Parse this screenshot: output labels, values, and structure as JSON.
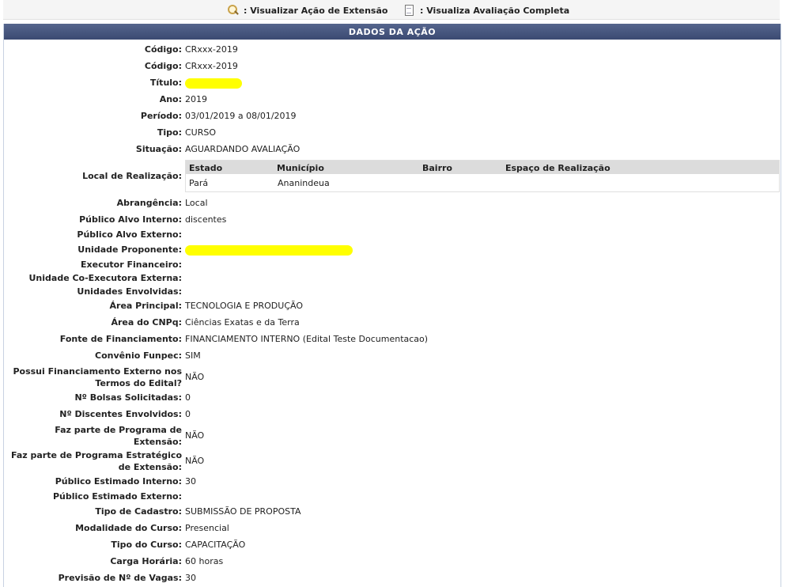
{
  "toolbar": {
    "view_action_label": ": Visualizar Ação de Extensão",
    "view_evaluation_label": ": Visualiza Avaliação Completa"
  },
  "panel": {
    "caption": "DADOS DA AÇÃO"
  },
  "fields": {
    "codigo1": {
      "label": "Código:",
      "value": "CRxxx-2019"
    },
    "codigo2": {
      "label": "Código:",
      "value": "CRxxx-2019"
    },
    "titulo": {
      "label": "Título:"
    },
    "ano": {
      "label": "Ano:",
      "value": "2019"
    },
    "periodo": {
      "label": "Período:",
      "value": "03/01/2019 a 08/01/2019"
    },
    "tipo": {
      "label": "Tipo:",
      "value": "CURSO"
    },
    "situacao": {
      "label": "Situação:",
      "value": "AGUARDANDO AVALIAÇÃO"
    },
    "local": {
      "label": "Local de Realização:"
    },
    "abrangencia": {
      "label": "Abrangência:",
      "value": "Local"
    },
    "publico_interno": {
      "label": "Público Alvo Interno:",
      "value": "discentes"
    },
    "publico_externo": {
      "label": "Público Alvo Externo:",
      "value": ""
    },
    "unidade_proponente": {
      "label": "Unidade Proponente:"
    },
    "executor": {
      "label": "Executor Financeiro:",
      "value": ""
    },
    "coexecutora": {
      "label": "Unidade Co-Executora Externa:",
      "value": ""
    },
    "envolvidas": {
      "label": "Unidades Envolvidas:",
      "value": ""
    },
    "area_principal": {
      "label": "Área Principal:",
      "value": "TECNOLOGIA E PRODUÇÃO"
    },
    "area_cnpq": {
      "label": "Área do CNPq:",
      "value": "Ciências Exatas e da Terra"
    },
    "fonte": {
      "label": "Fonte de Financiamento:",
      "value": "FINANCIAMENTO INTERNO (Edital Teste Documentacao)"
    },
    "convenio": {
      "label": "Convênio Funpec:",
      "value": "SIM"
    },
    "fin_externo": {
      "label_line1": "Possui Financiamento Externo nos",
      "label_line2": "Termos do Edital?",
      "value": "NÃO"
    },
    "bolsas": {
      "label": "Nº Bolsas Solicitadas:",
      "value": "0"
    },
    "discentes": {
      "label": "Nº Discentes Envolvidos:",
      "value": "0"
    },
    "programa": {
      "label_line1": "Faz parte de Programa de",
      "label_line2": "Extensão:",
      "value": "NÃO"
    },
    "estrategico": {
      "label_line1": "Faz parte de Programa Estratégico",
      "label_line2": "de Extensão:",
      "value": "NÃO"
    },
    "est_interno": {
      "label": "Público Estimado Interno:",
      "value": "30"
    },
    "est_externo": {
      "label": "Público Estimado Externo:",
      "value": ""
    },
    "cadastro": {
      "label": "Tipo de Cadastro:",
      "value": "SUBMISSÃO DE PROPOSTA"
    },
    "modalidade": {
      "label": "Modalidade do Curso:",
      "value": "Presencial"
    },
    "tipo_curso": {
      "label": "Tipo do Curso:",
      "value": "CAPACITAÇÃO"
    },
    "carga": {
      "label": "Carga Horária:",
      "value": "60 horas"
    },
    "vagas": {
      "label": "Previsão de Nº de Vagas:",
      "value": "30"
    }
  },
  "local_table": {
    "headers": [
      "Estado",
      "Município",
      "Bairro",
      "Espaço de Realização"
    ],
    "row": [
      "Pará",
      "Ananindeua",
      "",
      ""
    ]
  },
  "colors": {
    "caption_bg": "#3b4a72",
    "highlight": "#ffff00"
  }
}
